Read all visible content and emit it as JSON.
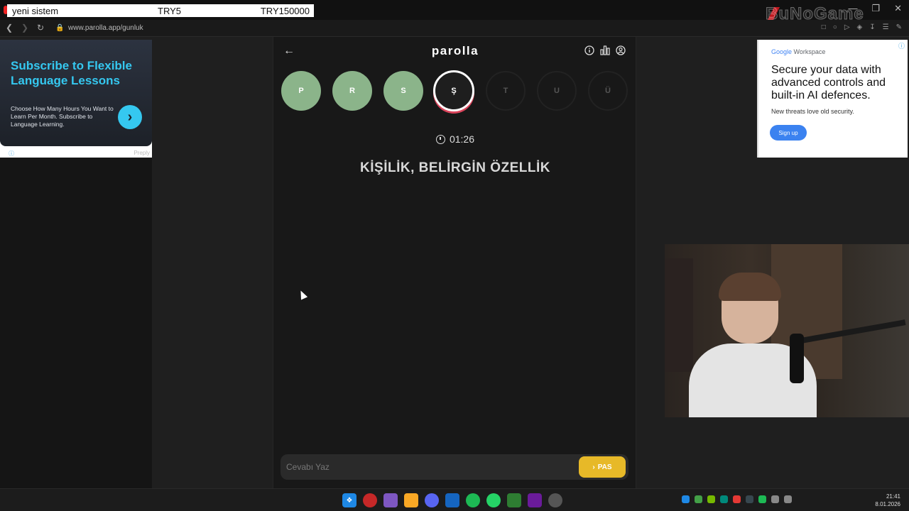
{
  "overlay": {
    "donation_name": "yeni sistem",
    "donation_amount_1": "TRY5",
    "donation_amount_2": "TRY150000",
    "brand": "BuNoGame"
  },
  "browser": {
    "url": "www.parolla.app/gunluk"
  },
  "ad_left": {
    "title": "Subscribe to Flexible Language Lessons",
    "body": "Choose How Many Hours You Want to Learn Per Month. Subscribe to Language Learning.",
    "cta_icon": "chevron-right-icon",
    "footer_brand": "Preply"
  },
  "ad_right": {
    "logo_google": "Google",
    "logo_workspace": " Workspace",
    "title": "Secure your data with advanced controls and built-in AI defences.",
    "body": "New threats love old security.",
    "button": "Sign up"
  },
  "app": {
    "logo": "parolla",
    "letters": [
      {
        "char": "P",
        "state": "done"
      },
      {
        "char": "R",
        "state": "done"
      },
      {
        "char": "S",
        "state": "done"
      },
      {
        "char": "Ş",
        "state": "active"
      },
      {
        "char": "T",
        "state": "todo"
      },
      {
        "char": "U",
        "state": "todo"
      },
      {
        "char": "Ü",
        "state": "todo"
      }
    ],
    "timer": "01:26",
    "question": "KİŞİLİK, BELİRGİN ÖZELLİK",
    "answer_placeholder": "Cevabı Yaz",
    "pass_label": "PAS"
  },
  "taskbar": {
    "time": "21:41",
    "date": "8.01.2026"
  },
  "colors": {
    "done": "#8bb48a",
    "active_ring": "#d9445b",
    "pass": "#e7b928",
    "ad_accent": "#35c8f0"
  }
}
